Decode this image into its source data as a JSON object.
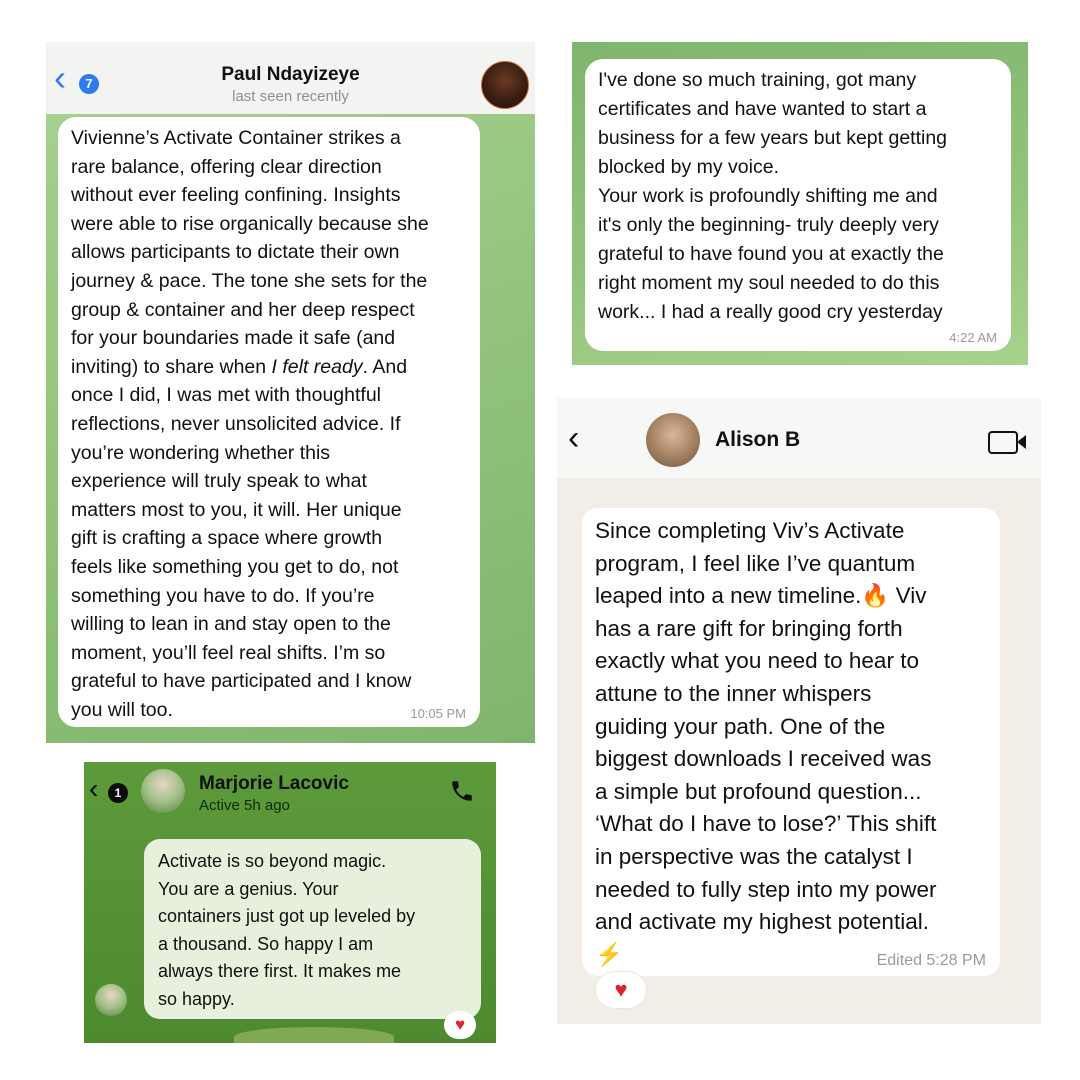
{
  "chat1": {
    "contact_name": "Paul Ndayizeye",
    "status": "last seen recently",
    "unread_count": "7",
    "message": "Vivienne’s Activate Container strikes a\nrare balance, offering clear direction\nwithout ever feeling confining. Insights\nwere able to rise organically because she\nallows participants to dictate their own\njourney & pace. The tone she sets for the\ngroup & container and her deep respect\nfor your boundaries made it safe (and\ninviting) to share when I felt ready. And\nonce I did, I was met with thoughtful\nreflections, never unsolicited advice. If\nyou’re wondering whether this\nexperience will truly speak to what\nmatters most to you, it will. Her unique\ngift is crafting a space where growth\nfeels like something you get to do, not\nsomething you have to do. If you’re\nwilling to lean in and stay open to the\nmoment, you’ll feel real shifts. I’m so\ngrateful to have participated and I know\nyou will too.",
    "time": "10:05 PM",
    "accent_color": "#2d7bf0"
  },
  "chat2": {
    "message": "I've done so much training, got many\ncertificates and have wanted to start a\nbusiness for a few years but kept getting\nblocked by my voice.\nYour work is profoundly shifting me and\nit's only the beginning- truly deeply very\ngrateful to have found you at exactly the\nright moment my soul needed to do this\nwork... I had a really good cry yesterday",
    "time": "4:22 AM"
  },
  "chat3": {
    "contact_name": "Marjorie Lacovic",
    "status": "Active 5h ago",
    "unread_count": "1",
    "message": "Activate is so beyond magic.\nYou are a genius. Your\ncontainers just got up leveled by\na thousand. So happy I am\nalways there first. It makes me\nso happy.",
    "reaction": "♥",
    "icons": [
      "chevron-left-icon",
      "phone-icon",
      "heart-icon"
    ]
  },
  "chat4": {
    "contact_name": "Alison B",
    "message": "Since completing Viv’s Activate\nprogram, I feel like I’ve quantum\nleaped into a new timeline.🔥 Viv\nhas a rare gift for bringing forth\nexactly what you need to hear to\nattune  to the inner whispers\nguiding your path. One of the\nbiggest downloads I received was\na simple but profound question...\n‘What do I have to lose?’ This shift\nin perspective was the catalyst I\nneeded to fully step into my power\nand activate my highest potential.\n⚡",
    "time": "Edited 5:28 PM",
    "reaction": "♥",
    "icons": [
      "chevron-left-icon",
      "video-call-icon",
      "heart-icon"
    ]
  }
}
